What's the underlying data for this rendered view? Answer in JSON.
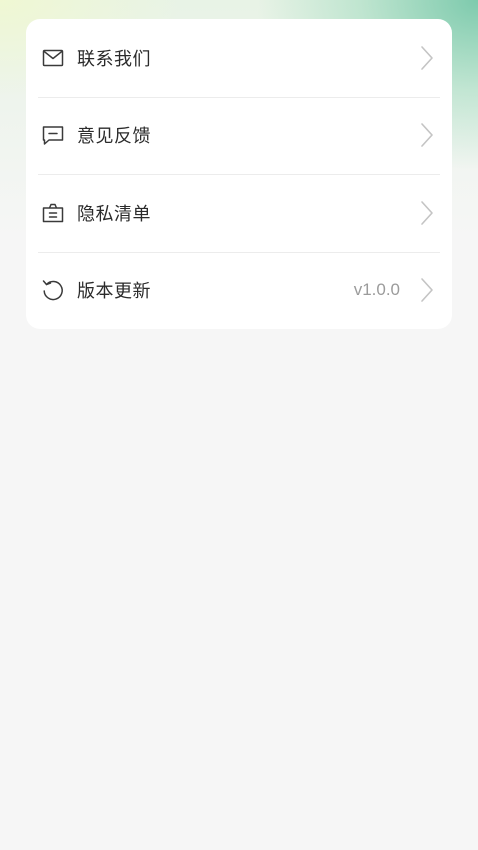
{
  "menu": {
    "items": [
      {
        "label": "联系我们",
        "icon": "mail-icon",
        "value": ""
      },
      {
        "label": "意见反馈",
        "icon": "feedback-icon",
        "value": ""
      },
      {
        "label": "隐私清单",
        "icon": "privacy-list-icon",
        "value": ""
      },
      {
        "label": "版本更新",
        "icon": "refresh-icon",
        "value": "v1.0.0"
      }
    ]
  }
}
